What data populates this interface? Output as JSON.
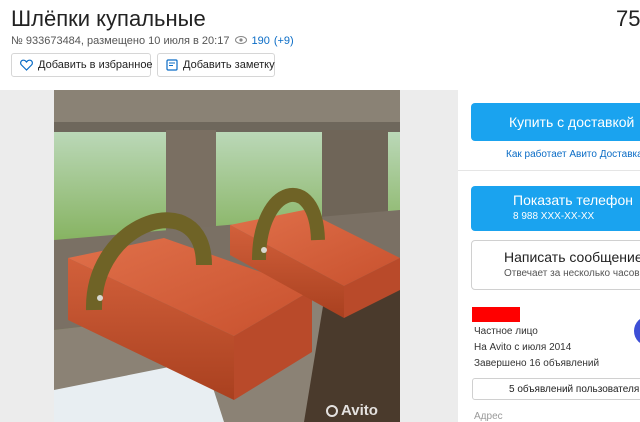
{
  "listing": {
    "title": "Шлёпки купальные",
    "price": "75",
    "meta": "№ 933673484, размещено 10 июля в 20:17",
    "views": "190",
    "views_delta": "(+9)"
  },
  "actions": {
    "favorite_label": "Добавить в избранное",
    "note_label": "Добавить заметку"
  },
  "gallery": {
    "watermark": "Avito"
  },
  "sidebar": {
    "buy_label": "Купить с доставкой",
    "how_it_works": "Как работает Авито Доставка",
    "phone_label": "Показать телефон",
    "phone_number": "8 988 XXX-XX-XX",
    "message_label": "Написать сообщение",
    "message_sub": "Отвечает за несколько часов",
    "seller_type": "Частное лицо",
    "seller_since": "На Avito с июля 2014",
    "seller_completed": "Завершено 16 объявлений",
    "seller_ads_button": "5 объявлений пользователя",
    "address_label": "Адрес"
  },
  "colors": {
    "accent": "#1aa3ef",
    "link": "#0a6cc6",
    "redaction": "#ff0000"
  },
  "icons": {
    "views": "eye-icon",
    "favorite": "heart-icon",
    "note": "note-icon"
  }
}
